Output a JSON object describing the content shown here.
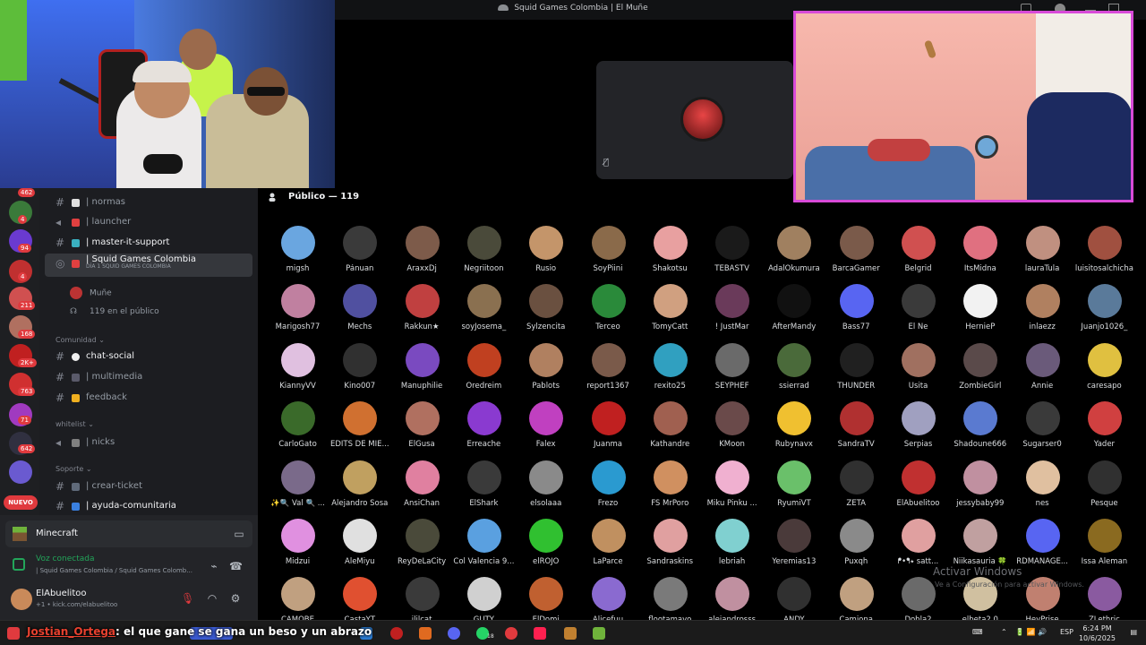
{
  "window": {
    "title": "Squid Games Colombia | El Muñe"
  },
  "server_badges": [
    "462",
    "4",
    "94",
    "4",
    "211",
    "168",
    "2K+",
    "763",
    "71",
    "642"
  ],
  "nuevo_label": "NUEVO",
  "channels": [
    {
      "label": "| normas",
      "bright": false
    },
    {
      "label": "| launcher",
      "bright": false
    },
    {
      "label": "| master-it-support",
      "bright": true
    }
  ],
  "active_channel": {
    "label": "| Squid Games Colombia",
    "sub": "DÍA 1 SQUID GAMES COLOMBIA"
  },
  "voice_user": "Muñe",
  "voice_audience": "119 en el público",
  "categories": {
    "comunidad": "Comunidad",
    "whitelist": "whitelist",
    "soporte": "Soporte"
  },
  "comunidad_channels": [
    "chat-social",
    "| multimedia",
    "feedback"
  ],
  "whitelist_channels": [
    "| nicks"
  ],
  "soporte_channels": [
    "| crear-ticket",
    "| ayuda-comunitaria"
  ],
  "panel": {
    "activity": "Minecraft",
    "voice_status": "Voz conectada",
    "voice_channel": "| Squid Games Colombia / Squid Games Colomb...",
    "username": "ElAbuelitoo",
    "user_sub": "+1 • kick.com/elabuelitoo"
  },
  "audience": {
    "title": "Público — 119",
    "members": [
      "migsh",
      "Pánuan",
      "AraxxDj",
      "Negriitoon",
      "Rusio",
      "SoyPiini",
      "Shakotsu",
      "TEBASTV",
      "AdalOkumura",
      "BarcaGamer",
      "Belgrid",
      "ItsMidna",
      "lauraTula",
      "luisitosalchicha",
      "Marigosh77",
      "Mechs",
      "Rakkun★",
      "soyJosema_",
      "Sylzencita",
      "Terceo",
      "TomyCatt",
      "! JustMar",
      "AfterMandy",
      "Bass77",
      "El Ñe",
      "HernieP",
      "inlaezz",
      "Juanjo1026_",
      "KiannyVV",
      "Kino007",
      "Manuphilie",
      "Oredreim",
      "Pablots",
      "report1367",
      "rexito25",
      "SEYPHEF",
      "ssierrad",
      "THUNDER",
      "Usita",
      "ZombieGirl",
      "Annie",
      "caresapo",
      "CarloGato",
      "EDITS DE MIE...",
      "ElGusa",
      "Erreache",
      "Falex",
      "Juanma",
      "Kathandre",
      "KMoon",
      "Rubynavx",
      "SandraTV",
      "Serpias",
      "Shadoune666",
      "Sugarser0",
      "Yader",
      "✨🔍 Val 🔍 ...",
      "Alejandro Sosa",
      "AnsiChan",
      "ElShark",
      "elsolaaa",
      "Frezo",
      "FS MrPoro",
      "Miku Pinku ...",
      "RyumiVT",
      "ZETA",
      "ElAbuelitoo",
      "jessybaby99",
      "nes",
      "Pesque",
      "Midzui",
      "AleMiyu",
      "ReyDeLaCity",
      "Col Valencia 9...",
      "elROJO",
      "LaParce",
      "Sandraskins",
      "lebriah",
      "Yeremias13",
      "Puxqh",
      "ᖰ•ᖳ⭑ satt...",
      "Niikasauria 🍀",
      "RDMANAGE...",
      "Issa Aleman",
      "CAMOBE",
      "CastaYT",
      "ililcat",
      "GUTY",
      "ElDomi",
      "Alicefuu",
      "flootamayo",
      "alejandrosss",
      "ANDY",
      "Camiona",
      "Dobla2",
      "elbeta2.0",
      "HeyPrise",
      "ZLethric"
    ],
    "colors": [
      "#6aa6e0",
      "#3a3a3a",
      "#7d5b4a",
      "#4a4a3a",
      "#c4956a",
      "#8a6a4a",
      "#e8a0a0",
      "#1a1a1a",
      "#a08060",
      "#7a5a4a",
      "#d05050",
      "#e07080",
      "#c09080",
      "#a05040",
      "#c080a0",
      "#5050a0",
      "#c04040",
      "#8a7050",
      "#6a5040",
      "#2a8a3a",
      "#d0a080",
      "#6a3a5a",
      "#111111",
      "#5865f2",
      "#3a3a3a",
      "#f2f2f2",
      "#b08060",
      "#5a7a9a",
      "#e0c0e0",
      "#303030",
      "#7a4ac0",
      "#c04020",
      "#b08060",
      "#7a5a4a",
      "#30a0c0",
      "#6a6a6a",
      "#4a6a3a",
      "#202020",
      "#a07060",
      "#5a4a4a",
      "#6a5a7a",
      "#e0c040",
      "#3a6a2a",
      "#d07030",
      "#b07060",
      "#8a3ad0",
      "#c040c0",
      "#c02020",
      "#a06050",
      "#6a4a4a",
      "#f0c030",
      "#b03030",
      "#a0a0c0",
      "#5a7ad0",
      "#3a3a3a",
      "#d04040",
      "#7a6a8a",
      "#c0a060",
      "#e080a0",
      "#3a3a3a",
      "#8a8a8a",
      "#2a9ad0",
      "#d09060",
      "#f0b0d0",
      "#6ac06a",
      "#303030",
      "#c03030",
      "#c090a0",
      "#e0c0a0",
      "#303030",
      "#e090e0",
      "#e0e0e0",
      "#4a4a3a",
      "#5aa0e0",
      "#30c030",
      "#c09060",
      "#e0a0a0",
      "#80d0d0",
      "#4a3a3a",
      "#8a8a8a",
      "#e0a0a0",
      "#c0a0a0",
      "#5865f2",
      "#8a6a20",
      "#c0a080",
      "#e05030",
      "#3a3a3a",
      "#d0d0d0",
      "#c06030",
      "#8a6ad0",
      "#7a7a7a",
      "#c090a0",
      "#303030",
      "#c0a080",
      "#6a6a6a",
      "#d0c0a0",
      "#c08070",
      "#8a5aa0"
    ]
  },
  "watermark": {
    "title": "Activar Windows",
    "sub": "Ve a Configuración para activar Windows."
  },
  "subtitle": {
    "name": "Jostian_Ortega",
    "text": ": el que gane se gana un beso y un abrazo"
  },
  "taskbar": {
    "lang": "ESP",
    "time": "6:24 PM",
    "date": "10/6/2025",
    "badge_whatsapp": "18"
  }
}
